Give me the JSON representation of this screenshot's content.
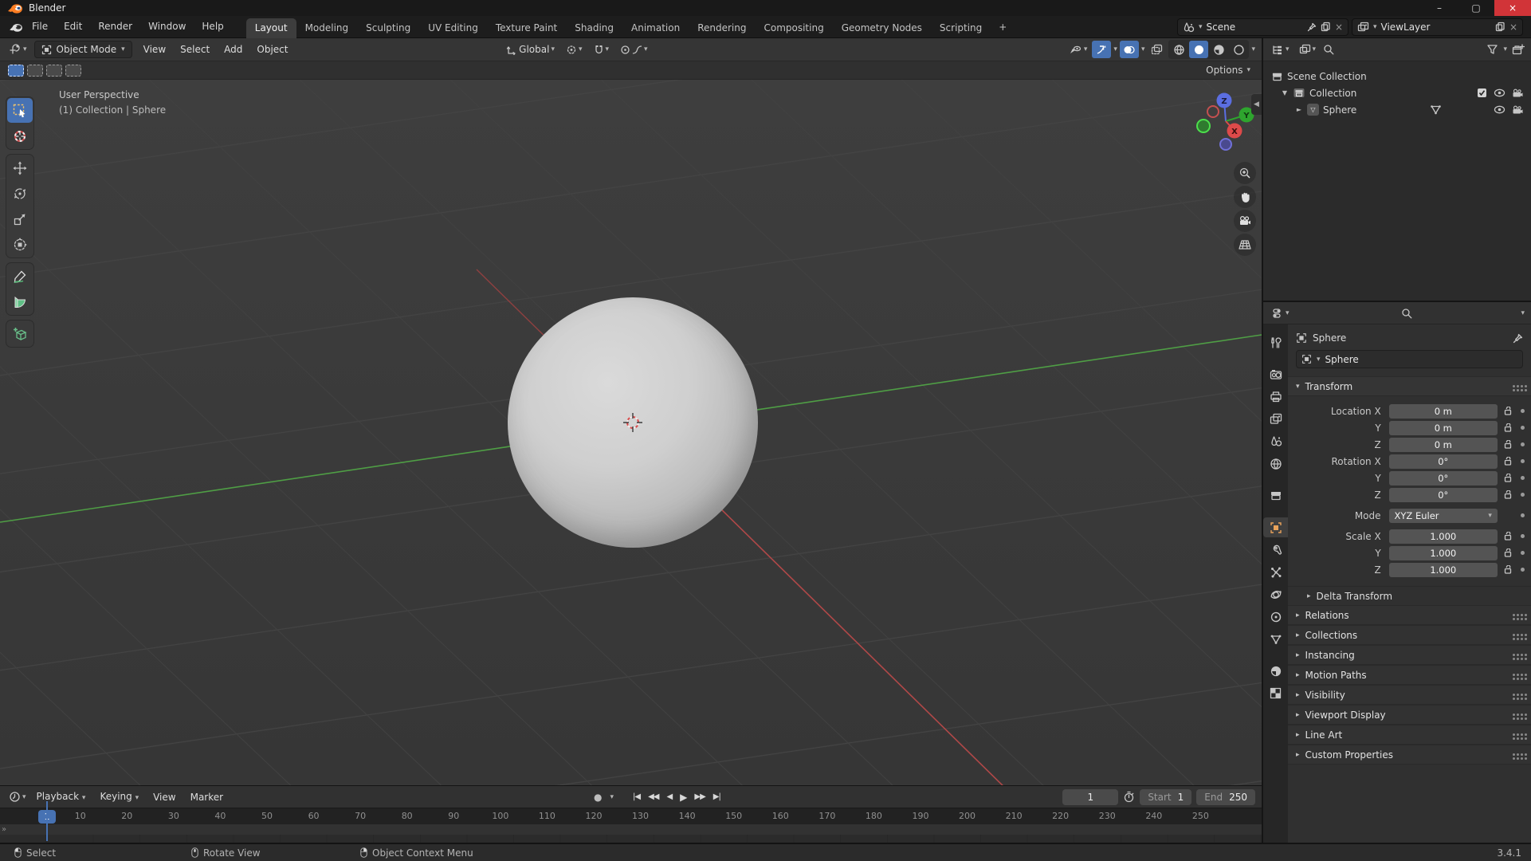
{
  "window": {
    "title": "Blender",
    "minimize": "–",
    "maximize": "▢",
    "close": "×"
  },
  "topbar": {
    "menus": [
      "File",
      "Edit",
      "Render",
      "Window",
      "Help"
    ],
    "tabs": [
      {
        "label": "Layout",
        "active": true
      },
      {
        "label": "Modeling",
        "active": false
      },
      {
        "label": "Sculpting",
        "active": false
      },
      {
        "label": "UV Editing",
        "active": false
      },
      {
        "label": "Texture Paint",
        "active": false
      },
      {
        "label": "Shading",
        "active": false
      },
      {
        "label": "Animation",
        "active": false
      },
      {
        "label": "Rendering",
        "active": false
      },
      {
        "label": "Compositing",
        "active": false
      },
      {
        "label": "Geometry Nodes",
        "active": false
      },
      {
        "label": "Scripting",
        "active": false
      }
    ],
    "add_tab": "+",
    "scene": "Scene",
    "view_layer": "ViewLayer"
  },
  "viewport_header": {
    "mode": "Object Mode",
    "menus": [
      "View",
      "Select",
      "Add",
      "Object"
    ],
    "orientation": "Global",
    "options_label": "Options"
  },
  "viewport": {
    "perspective_label": "User Perspective",
    "context_label": "(1) Collection | Sphere",
    "gizmo": {
      "x": "X",
      "y": "Y",
      "z": "Z",
      "x_color": "#dd4a4a",
      "y_color": "#2ea52e",
      "z_color": "#5b6ee1"
    },
    "axis_colors": {
      "x": "#a94444",
      "y": "#4f9e45"
    }
  },
  "toolbar": {
    "tools": [
      "select-box",
      "cursor",
      "move",
      "rotate",
      "scale",
      "transform",
      "annotate",
      "measure",
      "add-cube"
    ]
  },
  "outliner": {
    "rows": [
      {
        "label": "Scene Collection"
      },
      {
        "label": "Collection"
      },
      {
        "label": "Sphere"
      }
    ]
  },
  "properties": {
    "breadcrumb": "Sphere",
    "object_name": "Sphere",
    "transform": {
      "title": "Transform",
      "loc_rot_rows": [
        {
          "label": "Location X",
          "value": "0 m"
        },
        {
          "label": "Y",
          "value": "0 m"
        },
        {
          "label": "Z",
          "value": "0 m"
        },
        {
          "label": "Rotation X",
          "value": "0°"
        },
        {
          "label": "Y",
          "value": "0°"
        },
        {
          "label": "Z",
          "value": "0°"
        }
      ],
      "mode_label": "Mode",
      "mode_value": "XYZ Euler",
      "scale_rows": [
        {
          "label": "Scale X",
          "value": "1.000"
        },
        {
          "label": "Y",
          "value": "1.000"
        },
        {
          "label": "Z",
          "value": "1.000"
        }
      ],
      "sub_panel": "Delta Transform"
    },
    "collapsed_panels": [
      {
        "label": "Relations"
      },
      {
        "label": "Collections"
      },
      {
        "label": "Instancing"
      },
      {
        "label": "Motion Paths"
      },
      {
        "label": "Visibility"
      },
      {
        "label": "Viewport Display"
      },
      {
        "label": "Line Art"
      },
      {
        "label": "Custom Properties"
      }
    ]
  },
  "timeline": {
    "menus_dropdown": [
      "Playback",
      "Keying"
    ],
    "menus_plain": [
      "View",
      "Marker"
    ],
    "current_frame": "1",
    "start_label": "Start",
    "start_value": "1",
    "end_label": "End",
    "end_value": "250",
    "ruler_labels": [
      10,
      20,
      30,
      40,
      50,
      60,
      70,
      80,
      90,
      100,
      110,
      120,
      130,
      140,
      150,
      160,
      170,
      180,
      190,
      200,
      210,
      220,
      230,
      240,
      250
    ]
  },
  "statusbar": {
    "hints": [
      {
        "label": "Select"
      },
      {
        "label": "Rotate View"
      },
      {
        "label": "Object Context Menu"
      }
    ],
    "version": "3.4.1"
  }
}
